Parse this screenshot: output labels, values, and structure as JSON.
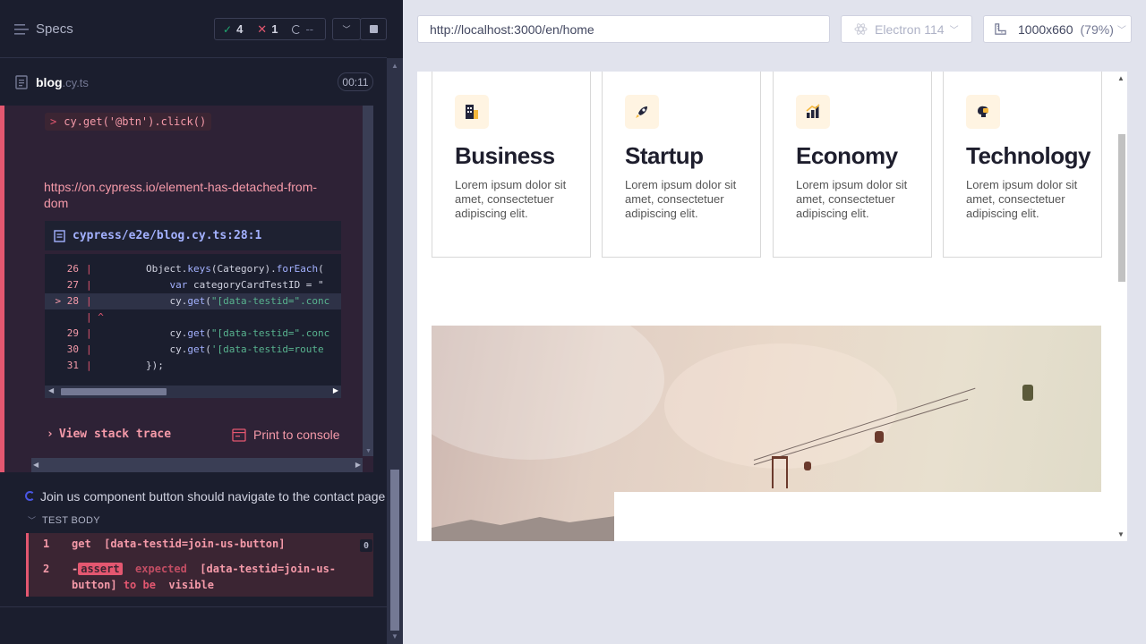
{
  "left": {
    "specs_label": "Specs",
    "stats": {
      "passed": "4",
      "failed": "1",
      "pending": "--"
    },
    "spec": {
      "name": "blog",
      "ext": ".cy.ts",
      "time": "00:11"
    },
    "error": {
      "command": "cy.get('@btn').click()",
      "link": "https://on.cypress.io/element-has-detached-from-dom",
      "file": "cypress/e2e/blog.cy.ts:28:1",
      "code_lines": [
        {
          "n": "26",
          "t": "        Object.keys(Category).forEach("
        },
        {
          "n": "27",
          "t": "            var categoryCardTestID = \""
        },
        {
          "n": "28",
          "t": "            cy.get(\"[data-testid=\".conc"
        },
        {
          "n": "",
          "t": "^"
        },
        {
          "n": "29",
          "t": "            cy.get(\"[data-testid=\".conc"
        },
        {
          "n": "30",
          "t": "            cy.get('[data-testid=route"
        },
        {
          "n": "31",
          "t": "        });"
        }
      ],
      "stack_trace": "View stack trace",
      "print_console": "Print to console"
    },
    "test2": {
      "title": "Join us component button should navigate to the contact page",
      "body_label": "TEST BODY",
      "cmd1_num": "1",
      "cmd1_name": "get",
      "cmd1_arg": "[data-testid=join-us-button]",
      "cmd2_num": "2",
      "cmd2_dash": "-",
      "cmd2_name": "assert",
      "cmd2_expected": "expected",
      "cmd2_subject": "[data-testid=join-us-",
      "cmd2_subject2": "button]",
      "cmd2_tobe": "to be",
      "cmd2_value": "visible",
      "badge": "0"
    }
  },
  "right": {
    "url": "http://localhost:3000/en/home",
    "browser": "Electron 114",
    "viewport": "1000x660",
    "zoom": "(79%)",
    "cards": [
      {
        "title": "Business",
        "body": "Lorem ipsum dolor sit amet, consectetuer adipiscing elit.",
        "icon": "building-icon"
      },
      {
        "title": "Startup",
        "body": "Lorem ipsum dolor sit amet, consectetuer adipiscing elit.",
        "icon": "rocket-icon"
      },
      {
        "title": "Economy",
        "body": "Lorem ipsum dolor sit amet, consectetuer adipiscing elit.",
        "icon": "bar-chart-icon"
      },
      {
        "title": "Technology",
        "body": "Lorem ipsum dolor sit amet, consectetuer adipiscing elit.",
        "icon": "brain-chip-icon"
      }
    ]
  },
  "colors": {
    "accent": "#e45770",
    "bg_dark": "#1b1e2e",
    "pass": "#1fa971",
    "fail": "#e45770"
  }
}
